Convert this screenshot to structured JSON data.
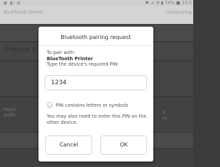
{
  "background": {
    "status_left": "▣ ◧ ▤",
    "status_right": "✱ ⊿ ◔ ▮ 74% ■ 15:0",
    "app_title": "BlueTooth Demo",
    "app_status": "connecting",
    "hint_text": "Please P",
    "paper_label_1": "Paper",
    "paper_label_2": "width:",
    "right_label_1": "3",
    "right_label_2": "m"
  },
  "dialog": {
    "title": "Bluetooth pairing request",
    "intro": "To pair with:",
    "device_name": "BlueTooth Printer",
    "instruction": "Type the device's required PIN:",
    "pin_value": "1234",
    "checkbox_label": "PIN contains letters or symbols",
    "checkbox_checked": false,
    "note": "You may also need to enter this PIN on the other device.",
    "cancel_label": "Cancel",
    "ok_label": "OK"
  }
}
